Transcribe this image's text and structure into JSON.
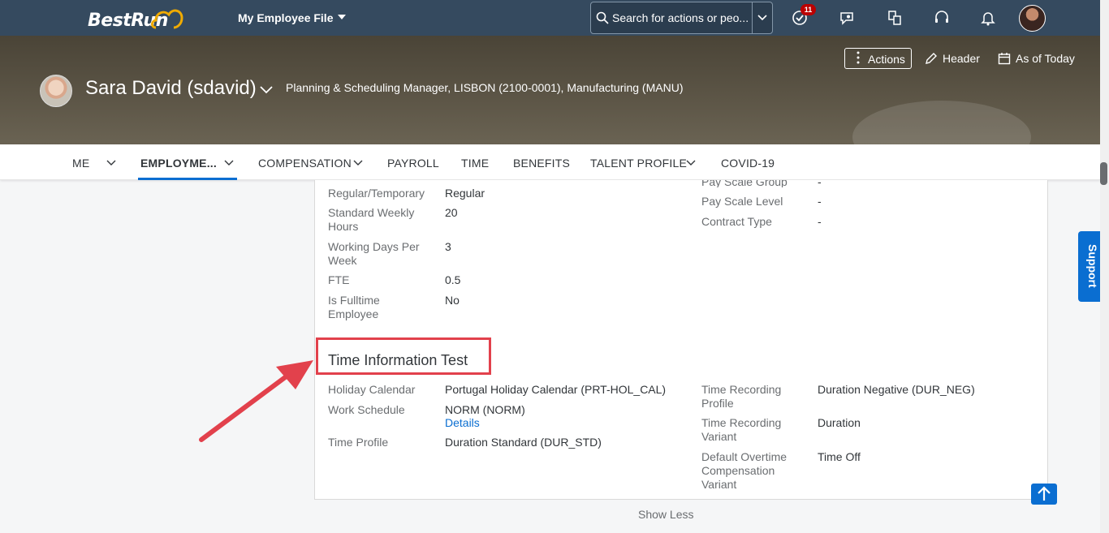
{
  "shell": {
    "logo_text": "BestRun",
    "app_title": "My Employee File",
    "search_placeholder": "Search for actions or peo...",
    "notifications_count": "11"
  },
  "header": {
    "actions_label": "Actions",
    "header_label": "Header",
    "as_of_label": "As of Today",
    "employee_name": "Sara David (sdavid)",
    "employee_title": "Planning & Scheduling Manager, LISBON (2100-0001), Manufacturing (MANU)"
  },
  "tabs": [
    {
      "label": "ME"
    },
    {
      "label": "EMPLOYME..."
    },
    {
      "label": "COMPENSATION"
    },
    {
      "label": "PAYROLL"
    },
    {
      "label": "TIME"
    },
    {
      "label": "BENEFITS"
    },
    {
      "label": "TALENT PROFILE"
    },
    {
      "label": "COVID-19"
    }
  ],
  "job_info": {
    "left": [
      {
        "label": "Regular/Temporary",
        "value": "Regular"
      },
      {
        "label": "Standard Weekly Hours",
        "value": "20"
      },
      {
        "label": "Working Days Per Week",
        "value": "3"
      },
      {
        "label": "FTE",
        "value": "0.5"
      },
      {
        "label": "Is Fulltime Employee",
        "value": "No"
      }
    ],
    "right": [
      {
        "label": "Pay Scale Group",
        "value": "-"
      },
      {
        "label": "Pay Scale Level",
        "value": "-"
      },
      {
        "label": "Contract Type",
        "value": "-"
      }
    ]
  },
  "time_info": {
    "title": "Time Information Test",
    "left": [
      {
        "label": "Holiday Calendar",
        "value": "Portugal Holiday Calendar (PRT-HOL_CAL)"
      },
      {
        "label": "Work Schedule",
        "value": "NORM (NORM)",
        "link": "Details"
      },
      {
        "label": "Time Profile",
        "value": "Duration Standard (DUR_STD)"
      }
    ],
    "right": [
      {
        "label": "Time Recording Profile",
        "value": "Duration Negative (DUR_NEG)"
      },
      {
        "label": "Time Recording Variant",
        "value": "Duration"
      },
      {
        "label": "Default Overtime Compensation Variant",
        "value": "Time Off"
      }
    ]
  },
  "footer": {
    "show_less": "Show Less",
    "support_label": "Support"
  },
  "colors": {
    "shell": "#354a5f",
    "accent": "#0a6ed1",
    "annotation": "#e2414c"
  }
}
